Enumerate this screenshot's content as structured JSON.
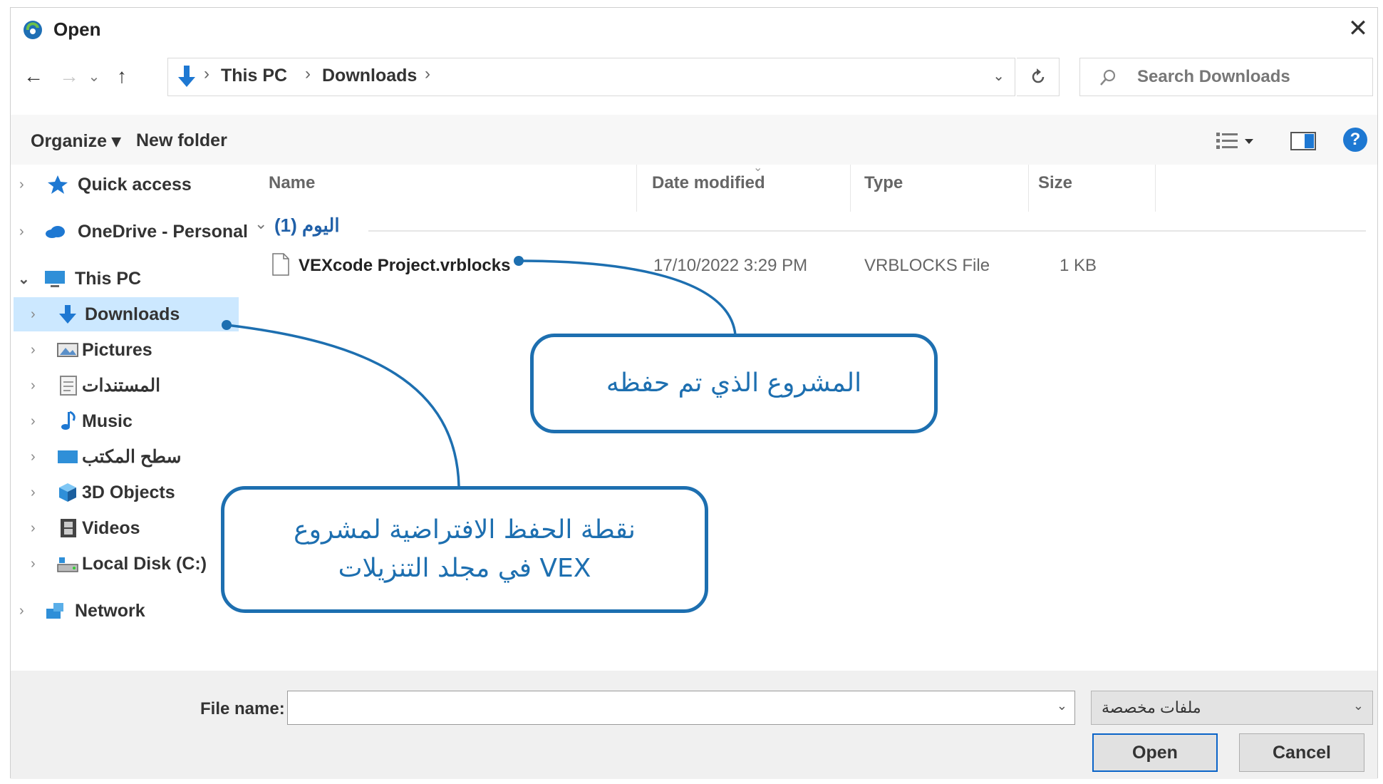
{
  "window": {
    "title": "Open",
    "close_symbol": "✕"
  },
  "nav": {
    "back_symbol": "←",
    "forward_symbol": "→",
    "recent_symbol": "⌄",
    "up_symbol": "↑",
    "breadcrumbs": [
      "This PC",
      "Downloads"
    ],
    "crumb_separator": "›",
    "search_placeholder": "Search Downloads"
  },
  "toolbar": {
    "organize_label": "Organize ▾",
    "new_folder_label": "New folder",
    "help_symbol": "?"
  },
  "sidebar": {
    "items": [
      {
        "label": "Quick access",
        "icon": "star-icon"
      },
      {
        "label": "OneDrive - Personal",
        "icon": "cloud-icon"
      },
      {
        "label": "This PC",
        "icon": "computer-icon"
      },
      {
        "label": "Downloads",
        "icon": "download-arrow-icon"
      },
      {
        "label": "Pictures",
        "icon": "pictures-icon"
      },
      {
        "label": "المستندات",
        "icon": "documents-icon"
      },
      {
        "label": "Music",
        "icon": "music-note-icon"
      },
      {
        "label": "سطح المكتب",
        "icon": "desktop-icon"
      },
      {
        "label": "3D Objects",
        "icon": "cube-icon"
      },
      {
        "label": "Videos",
        "icon": "film-icon"
      },
      {
        "label": "Local Disk (C:)",
        "icon": "drive-icon"
      },
      {
        "label": "Network",
        "icon": "network-icon"
      }
    ]
  },
  "file_list": {
    "columns": [
      "Name",
      "Date modified",
      "Type",
      "Size"
    ],
    "group_label": "اليوم (1)",
    "rows": [
      {
        "name": "VEXcode Project.vrblocks",
        "date": "17/10/2022 3:29 PM",
        "type": "VRBLOCKS File",
        "size": "1 KB"
      }
    ]
  },
  "footer": {
    "file_name_label": "File name:",
    "file_name_value": "",
    "file_type": "ملفات مخصصة",
    "open_label": "Open",
    "cancel_label": "Cancel"
  },
  "callouts": {
    "saved_project": "المشروع الذي تم حفظه",
    "default_save_line1": "نقطة الحفظ الافتراضية لمشروع",
    "default_save_line2": "VEX في مجلد التنزيلات"
  },
  "colors": {
    "accent": "#1d6fb0",
    "selection": "#cce8ff",
    "open_button_border": "#0a64c8"
  }
}
